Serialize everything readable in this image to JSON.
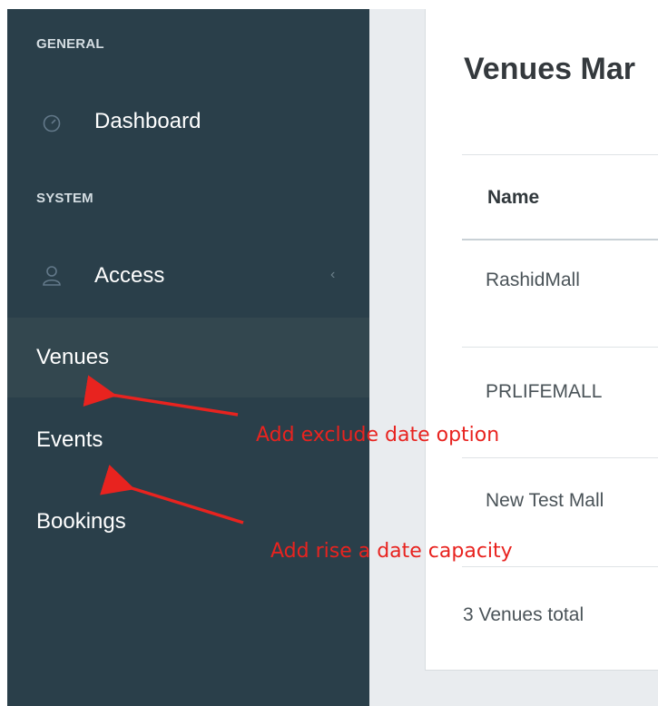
{
  "sidebar": {
    "section_general": "GENERAL",
    "section_system": "SYSTEM",
    "items": [
      {
        "label": "Dashboard",
        "icon": "dashboard-gauge-icon"
      },
      {
        "label": "Access",
        "icon": "user-icon",
        "chevron": "‹"
      },
      {
        "label": "Venues"
      },
      {
        "label": "Events"
      },
      {
        "label": "Bookings"
      }
    ],
    "colors": {
      "background": "#2a3f4a",
      "active": "#33474f",
      "text": "#ffffff"
    }
  },
  "main": {
    "title": "Venues Mar",
    "table": {
      "columns": [
        "Name"
      ],
      "rows": [
        {
          "name": "RashidMall"
        },
        {
          "name": "PRLIFEMALL"
        },
        {
          "name": "New Test Mall"
        }
      ]
    },
    "total": "3 Venues total"
  },
  "annotations": [
    {
      "text": "Add exclude date option",
      "color": "#e8231f"
    },
    {
      "text": "Add rise a date capacity",
      "color": "#e8231f"
    }
  ]
}
